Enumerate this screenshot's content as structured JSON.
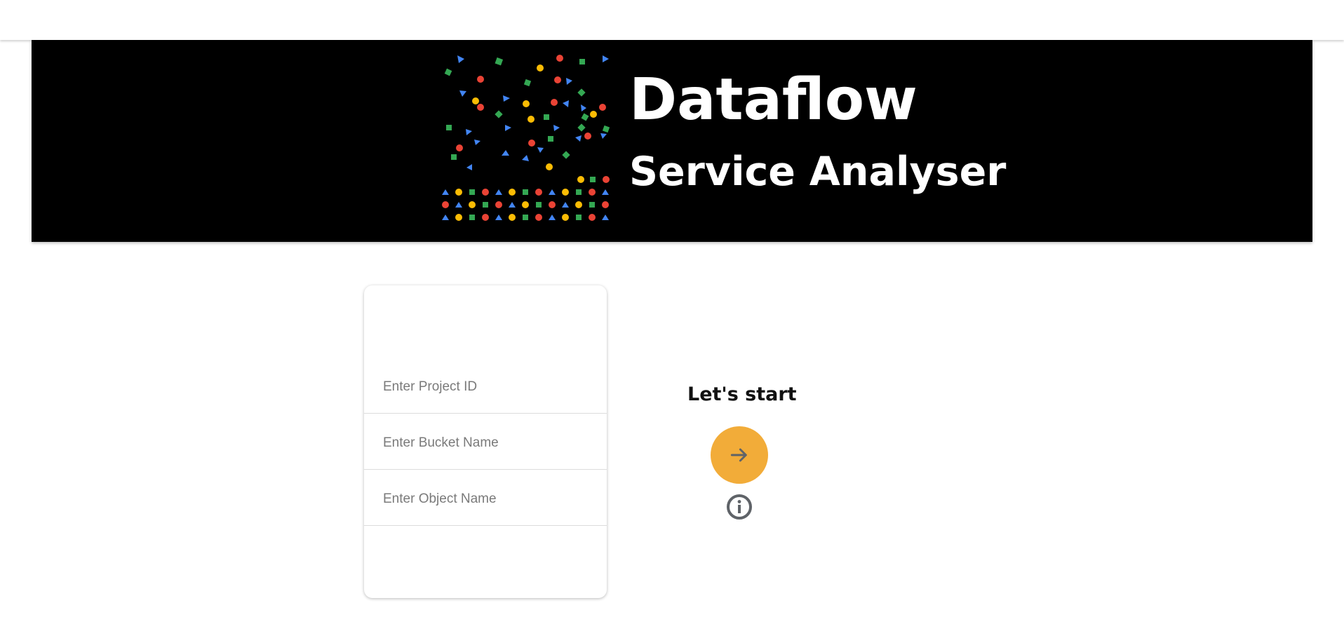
{
  "header": {
    "title": "Dataflow",
    "subtitle": "Service Analyser",
    "logo_icon": "confetti-shapes-logo"
  },
  "form": {
    "project_id_placeholder": "Enter Project ID",
    "project_id_value": "",
    "bucket_name_placeholder": "Enter Bucket Name",
    "bucket_name_value": "",
    "object_name_placeholder": "Enter Object Name",
    "object_name_value": ""
  },
  "actions": {
    "start_label": "Let's start",
    "start_icon": "arrow-right-icon",
    "info_icon": "info-icon"
  },
  "colors": {
    "banner_bg": "#000000",
    "accent": "#f2ac39",
    "logo_red": "#ea4335",
    "logo_yellow": "#fbbc04",
    "logo_green": "#34a853",
    "logo_blue": "#4285f4"
  }
}
